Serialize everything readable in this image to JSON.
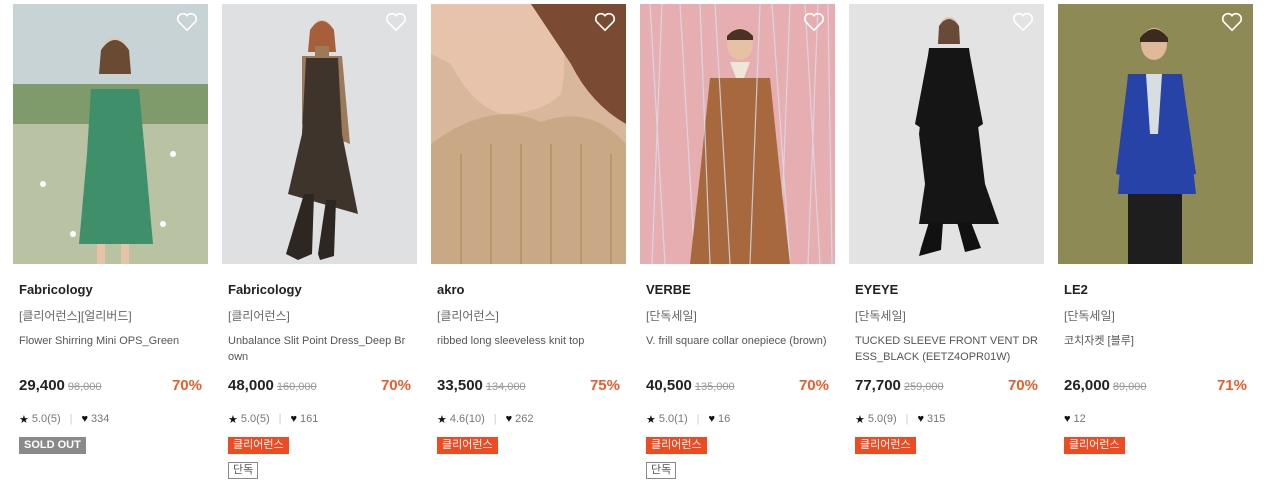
{
  "products": [
    {
      "brand": "Fabricology",
      "tagline": "[클리어런스][얼리버드]",
      "name": "Flower Shirring Mini OPS_Green",
      "price": "29,400",
      "original_price": "98,000",
      "discount": "70%",
      "rating": "5.0(5)",
      "likes": "334",
      "badges": [
        "SOLD OUT"
      ],
      "badge_styles": [
        "gray"
      ],
      "bg": "#8ea97b",
      "accent": "#3f8f6a"
    },
    {
      "brand": "Fabricology",
      "tagline": "[클리어런스]",
      "name": "Unbalance Slit Point Dress_Deep Brown",
      "price": "48,000",
      "original_price": "160,000",
      "discount": "70%",
      "rating": "5.0(5)",
      "likes": "161",
      "badges": [
        "클리어런스",
        "단독"
      ],
      "badge_styles": [
        "orange",
        "outline"
      ],
      "bg": "#dfe0e2",
      "accent": "#3e342c"
    },
    {
      "brand": "akro",
      "tagline": "[클리어런스]",
      "name": "ribbed long sleeveless knit top",
      "price": "33,500",
      "original_price": "134,000",
      "discount": "75%",
      "rating": "4.6(10)",
      "likes": "262",
      "badges": [
        "클리어런스"
      ],
      "badge_styles": [
        "orange"
      ],
      "bg": "#d9b79c",
      "accent": "#c9a985"
    },
    {
      "brand": "VERBE",
      "tagline": "[단독세일]",
      "name": "V. frill square collar onepiece (brown)",
      "price": "40,500",
      "original_price": "135,000",
      "discount": "70%",
      "rating": "5.0(1)",
      "likes": "16",
      "badges": [
        "클리어런스",
        "단독"
      ],
      "badge_styles": [
        "orange",
        "outline"
      ],
      "bg": "#e6aeb0",
      "accent": "#a8683e"
    },
    {
      "brand": "EYEYE",
      "tagline": "[단독세일]",
      "name": "TUCKED SLEEVE FRONT VENT DRESS_BLACK (EETZ4OPR01W)",
      "price": "77,700",
      "original_price": "259,000",
      "discount": "70%",
      "rating": "5.0(9)",
      "likes": "315",
      "badges": [
        "클리어런스"
      ],
      "badge_styles": [
        "orange"
      ],
      "bg": "#e3e3e3",
      "accent": "#151515"
    },
    {
      "brand": "LE2",
      "tagline": "[단독세일]",
      "name": "코치자켓 [블루]",
      "price": "26,000",
      "original_price": "89,000",
      "discount": "71%",
      "rating": "",
      "likes": "12",
      "badges": [
        "클리어런스"
      ],
      "badge_styles": [
        "orange"
      ],
      "bg": "#8e8a56",
      "accent": "#2743a8"
    }
  ]
}
